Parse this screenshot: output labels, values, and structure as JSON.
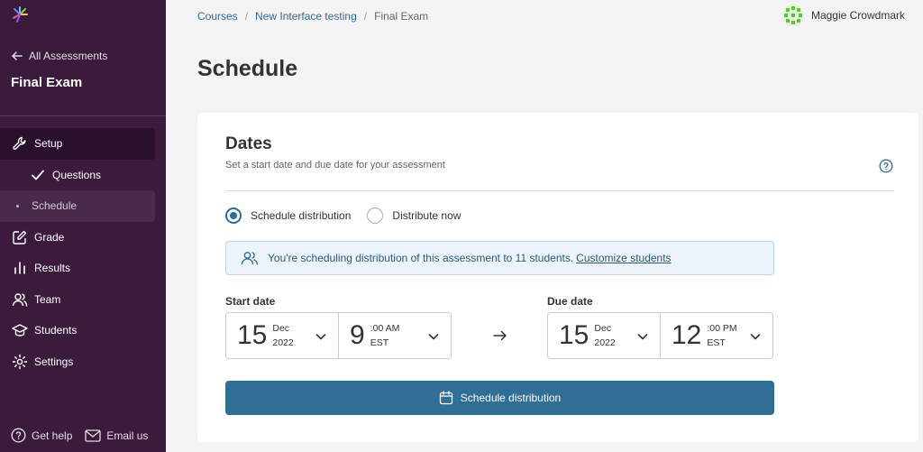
{
  "sidebar": {
    "back_label": "All Assessments",
    "exam_title": "Final Exam",
    "items": [
      {
        "label": "Setup"
      },
      {
        "label": "Questions"
      },
      {
        "label": "Schedule"
      },
      {
        "label": "Grade"
      },
      {
        "label": "Results"
      },
      {
        "label": "Team"
      },
      {
        "label": "Students"
      },
      {
        "label": "Settings"
      }
    ],
    "footer": {
      "help_label": "Get help",
      "email_label": "Email us"
    }
  },
  "breadcrumb": {
    "items": [
      "Courses",
      "New Interface testing",
      "Final Exam"
    ],
    "separator": "/"
  },
  "user": {
    "name": "Maggie Crowdmark"
  },
  "page": {
    "title": "Schedule"
  },
  "dates_card": {
    "title": "Dates",
    "subtitle": "Set a start date and due date for your assessment",
    "radio_schedule": "Schedule distribution",
    "radio_now": "Distribute now",
    "info_text": "You're scheduling distribution of this assessment to 11 students.",
    "info_link": "Customize students",
    "start": {
      "label": "Start date",
      "day": "15",
      "month": "Dec",
      "year": "2022",
      "hour": "9",
      "minutes_ampm": ":00 AM",
      "tz": "EST"
    },
    "due": {
      "label": "Due date",
      "day": "15",
      "month": "Dec",
      "year": "2022",
      "hour": "12",
      "minutes_ampm": ":00 PM",
      "tz": "EST"
    },
    "button_label": "Schedule distribution"
  },
  "colors": {
    "sidebar_bg": "#3b1a3b",
    "accent": "#2f6f96",
    "link": "#2d6b9a"
  }
}
